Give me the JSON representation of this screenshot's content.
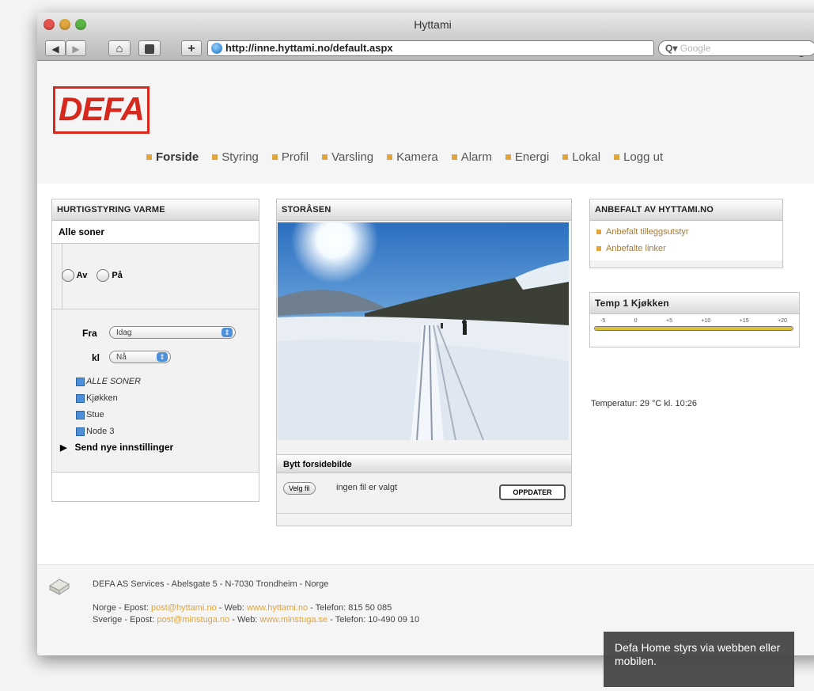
{
  "window": {
    "title": "Hyttami",
    "url": "http://inne.hyttami.no/default.aspx",
    "search_placeholder": "Google",
    "back": "◀",
    "forward": "▶",
    "home": "⌂",
    "add": "+",
    "reload": "C"
  },
  "brand": {
    "logo_text": "DEFA",
    "logo_color": "#d6281c"
  },
  "nav": {
    "items": [
      "Forside",
      "Styring",
      "Profil",
      "Varsling",
      "Kamera",
      "Alarm",
      "Energi",
      "Lokal",
      "Logg ut"
    ]
  },
  "left_panel": {
    "title": "HURTIGSTYRING VARME",
    "zone": "Alle soner",
    "radio_off": "Av",
    "radio_on": "På",
    "fra_label": "Fra",
    "fra_value": "Idag",
    "kl_label": "kl",
    "kl_value": "Nå",
    "checks": [
      "ALLE SONER",
      "Kjøkken",
      "Stue",
      "Node 3"
    ],
    "send": "Send nye innstillinger"
  },
  "center_panel": {
    "title": "STORÅSEN",
    "change_title": "Bytt forsidebilde",
    "choose_button": "Velg fil",
    "no_file": "ingen fil er valgt",
    "upload_button": "OPPDATER"
  },
  "right_panel": {
    "title": "ANBEFALT AV HYTTAMI.NO",
    "links": [
      "Anbefalt tilleggsutstyr",
      "Anbefalte linker"
    ],
    "temp_title": "Temp 1 Kjøkken",
    "scale": [
      "-5",
      "0",
      "+5",
      "+10",
      "+15",
      "+20"
    ],
    "temp_value": 29,
    "temp_text": "Temperatur:  29 °C kl.  10:26"
  },
  "footer": {
    "line1": "DEFA AS Services - Abelsgate 5 - N-7030 Trondheim - Norge",
    "no_prefix": "Norge - Epost:",
    "no_email": "post@hyttami.no",
    "no_web_label": "- Web:",
    "no_web": "www.hyttami.no",
    "no_phone": "- Telefon:  815 50 085",
    "se_prefix": "Sverige - Epost:",
    "se_email": "post@minstuga.no",
    "se_web_label": "- Web:",
    "se_web": "www.minstuga.se",
    "se_phone": "- Telefon:  10-490 09 10"
  },
  "caption": "Defa Home styrs via webben eller mobilen."
}
